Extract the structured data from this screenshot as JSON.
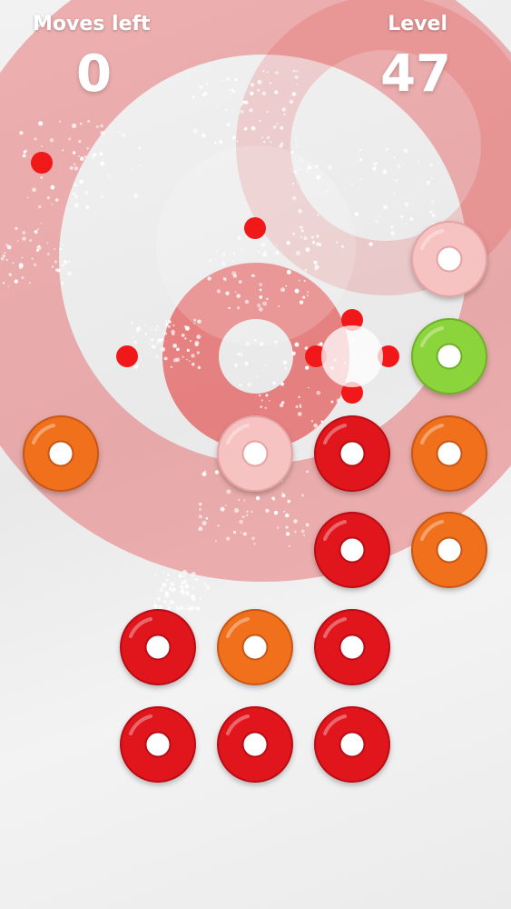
{
  "hud": {
    "moves_label": "Moves left",
    "moves_value": "0",
    "level_label": "Level",
    "level_value": "47"
  },
  "colors": {
    "red": "#e0141c",
    "orange": "#f0701e",
    "pink": "#f7c2c2",
    "green": "#8cd43a",
    "burst": "#e22a2a"
  },
  "board": {
    "rings": [
      {
        "row": 2,
        "col": 4,
        "color": "pink"
      },
      {
        "row": 3,
        "col": 4,
        "color": "green"
      },
      {
        "row": 4,
        "col": 0,
        "color": "orange"
      },
      {
        "row": 4,
        "col": 2,
        "color": "pink"
      },
      {
        "row": 4,
        "col": 3,
        "color": "red"
      },
      {
        "row": 4,
        "col": 4,
        "color": "orange"
      },
      {
        "row": 5,
        "col": 3,
        "color": "red"
      },
      {
        "row": 5,
        "col": 4,
        "color": "orange"
      },
      {
        "row": 6,
        "col": 1,
        "color": "red"
      },
      {
        "row": 6,
        "col": 2,
        "color": "orange"
      },
      {
        "row": 6,
        "col": 3,
        "color": "red"
      },
      {
        "row": 7,
        "col": 1,
        "color": "red"
      },
      {
        "row": 7,
        "col": 2,
        "color": "red"
      },
      {
        "row": 7,
        "col": 3,
        "color": "red"
      }
    ]
  }
}
